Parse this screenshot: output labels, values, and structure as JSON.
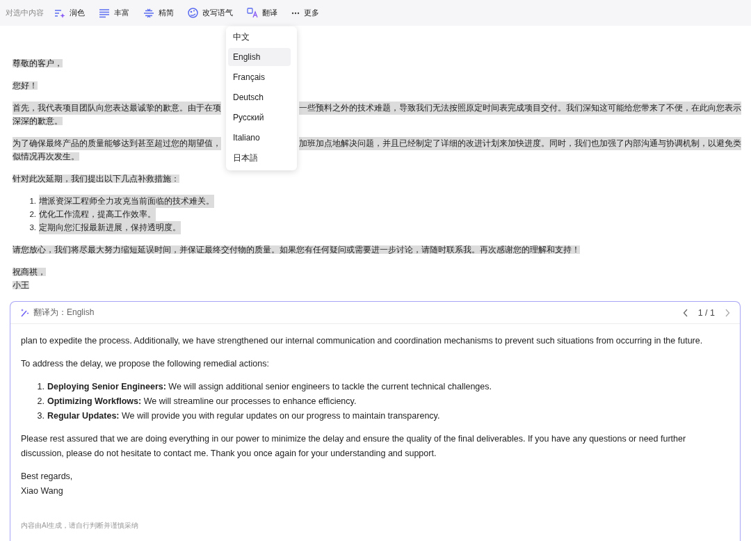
{
  "toolbar": {
    "label": "对选中内容",
    "actions": [
      {
        "kind": "polish",
        "label": "润色"
      },
      {
        "kind": "enrich",
        "label": "丰富"
      },
      {
        "kind": "condense",
        "label": "精简"
      },
      {
        "kind": "tone",
        "label": "改写语气"
      },
      {
        "kind": "translate",
        "label": "翻译"
      },
      {
        "kind": "more",
        "label": "更多"
      }
    ]
  },
  "document": {
    "blocks": [
      {
        "kind": "para",
        "lines": [
          [
            "尊敬的客户，"
          ]
        ]
      },
      {
        "kind": "para",
        "lines": [
          [
            "您好！"
          ]
        ]
      },
      {
        "kind": "para",
        "lines": [
          [
            "首先，我代表项目团队向您表达最诚挚的歉意。由于在项",
            "一些预料之外的技术难题，导致我们无法按照原定时间表完成项目交付。我们深知这可能给您带来了不便，在此向您表示"
          ],
          [
            "深深的歉意。"
          ]
        ]
      },
      {
        "kind": "para",
        "lines": [
          [
            "为了确保最终产品的质量能够达到甚至超过您的期望值，",
            "加班加点地解决问题，并且已经制定了详细的改进计划来加快进度。同时，我们也加强了内部沟通与协调机制，以避免类"
          ],
          [
            "似情况再次发生。"
          ]
        ]
      },
      {
        "kind": "para",
        "lines": [
          [
            "针对此次延期，我们提出以下几点补救措施："
          ]
        ]
      },
      {
        "kind": "list",
        "items": [
          {
            "number": "1.",
            "text": "增派资深工程师全力攻克当前面临的技术难关。"
          },
          {
            "number": "2.",
            "text": "优化工作流程，提高工作效率。"
          },
          {
            "number": "3.",
            "text": "定期向您汇报最新进展，保持透明度。"
          }
        ]
      },
      {
        "kind": "para",
        "lines": [
          [
            "请您放心，我们将尽最大努力缩短延误时间，并保证最终交付物的质量。如果您有任何疑问或需要进一步讨论，请随时联系我。再次感谢您的理解和支持！"
          ]
        ]
      },
      {
        "kind": "para",
        "lines": [
          [
            "祝商祺，"
          ],
          [
            "小王"
          ]
        ]
      }
    ]
  },
  "language_menu": {
    "items": [
      {
        "label": "中文",
        "selected": false
      },
      {
        "label": "English",
        "selected": true
      },
      {
        "label": "Français",
        "selected": false
      },
      {
        "label": "Deutsch",
        "selected": false
      },
      {
        "label": "Русский",
        "selected": false
      },
      {
        "label": "Italiano",
        "selected": false
      },
      {
        "label": "日本語",
        "selected": false
      }
    ]
  },
  "translation_panel": {
    "title": "翻译为：English",
    "pager": "1 / 1",
    "blocks": [
      {
        "kind": "para",
        "text": "plan to expedite the process. Additionally, we have strengthened our internal communication and coordination mechanisms to prevent such situations from occurring in the future."
      },
      {
        "kind": "para",
        "text": "To address the delay, we propose the following remedial actions:"
      },
      {
        "kind": "list",
        "items": [
          {
            "number": "1.",
            "text": "**Deploying Senior Engineers:** We will assign additional senior engineers to tackle the current technical challenges."
          },
          {
            "number": "2.",
            "text": "**Optimizing Workflows:** We will streamline our processes to enhance efficiency."
          },
          {
            "number": "3.",
            "text": "**Regular Updates:** We will provide you with regular updates on our progress to maintain transparency."
          }
        ]
      },
      {
        "kind": "para",
        "text": "Please rest assured that we are doing everything in our power to minimize the delay and ensure the quality of the final deliverables. If you have any questions or need further discussion, please do not hesitate to contact me. Thank you once again for your understanding and support."
      },
      {
        "kind": "lines",
        "lines": [
          "Best regards,",
          "Xiao Wang"
        ]
      }
    ],
    "disclaimer": "内容由AI生成，请自行判断并谨慎采纳"
  }
}
